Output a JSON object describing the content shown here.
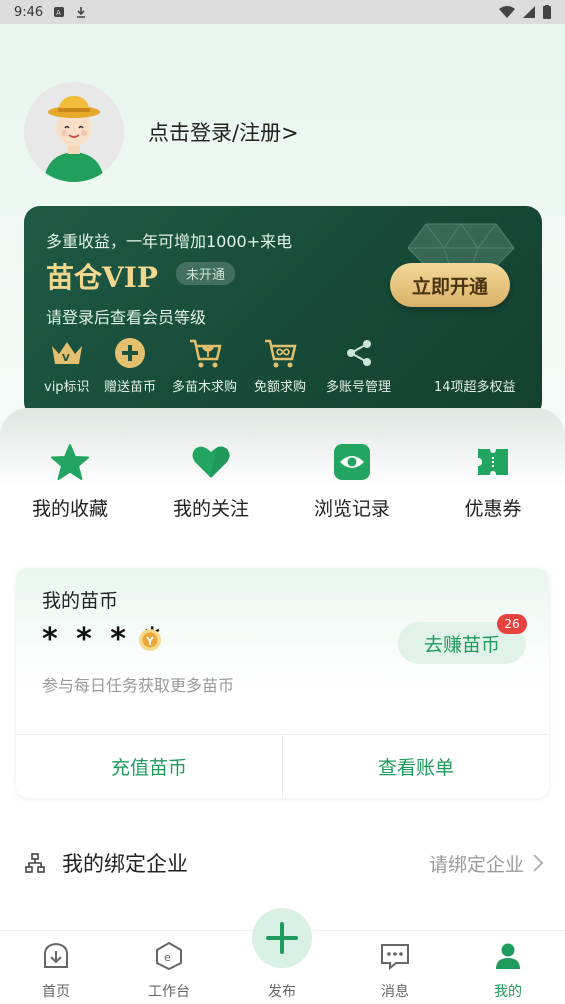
{
  "status_bar": {
    "time": "9:46"
  },
  "profile": {
    "login_label": "点击登录/注册>"
  },
  "vip": {
    "tagline": "多重收益，一年可增加1000+来电",
    "title": "苗仓VIP",
    "status": "未开通",
    "level_hint": "请登录后查看会员等级",
    "open_label": "立即开通",
    "benefits": [
      {
        "label": "vip标识",
        "icon": "crown-icon"
      },
      {
        "label": "赠送苗币",
        "icon": "plus-coin-icon"
      },
      {
        "label": "多苗木求购",
        "icon": "cart-plant-icon"
      },
      {
        "label": "免额求购",
        "icon": "cart-infinity-icon"
      },
      {
        "label": "多账号管理",
        "icon": "share-icon"
      }
    ],
    "more_label": "14项超多权益"
  },
  "quick_links": [
    {
      "label": "我的收藏",
      "icon": "star-icon"
    },
    {
      "label": "我的关注",
      "icon": "heart-icon"
    },
    {
      "label": "浏览记录",
      "icon": "eye-icon"
    },
    {
      "label": "优惠券",
      "icon": "ticket-icon"
    }
  ],
  "coin_card": {
    "title": "我的苗币",
    "masked_value": "* * * *",
    "hint": "参与每日任务获取更多苗币",
    "earn_label": "去赚苗币",
    "badge_count": "26",
    "recharge_label": "充值苗币",
    "bill_label": "查看账单"
  },
  "company": {
    "label": "我的绑定企业",
    "action": "请绑定企业"
  },
  "tabs": [
    {
      "label": "首页",
      "icon": "home-icon"
    },
    {
      "label": "工作台",
      "icon": "workbench-icon"
    },
    {
      "label": "发布",
      "icon": "publish-icon"
    },
    {
      "label": "消息",
      "icon": "message-icon"
    },
    {
      "label": "我的",
      "icon": "user-icon"
    }
  ],
  "colors": {
    "accent": "#1f9b5e",
    "vip_gold": "#f2d78e",
    "vip_bg": "#1b5340",
    "badge": "#e8423f"
  }
}
